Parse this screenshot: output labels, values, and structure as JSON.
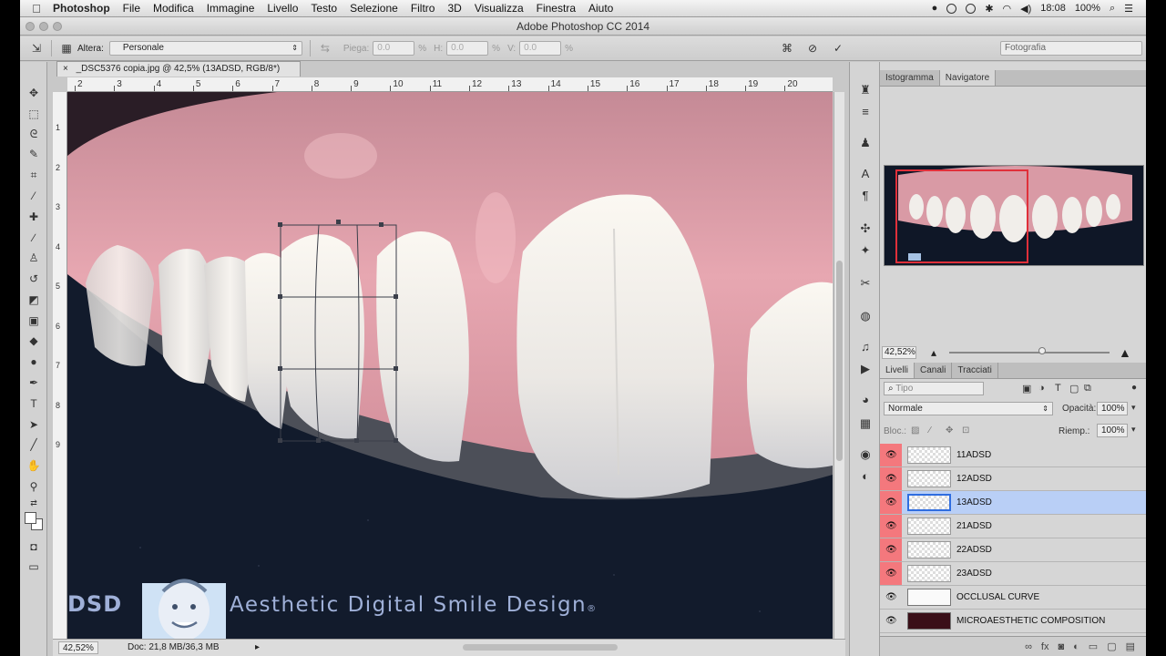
{
  "menubar": {
    "apple": "",
    "app": "Photoshop",
    "items": [
      "File",
      "Modifica",
      "Immagine",
      "Livello",
      "Testo",
      "Selezione",
      "Filtro",
      "3D",
      "Visualizza",
      "Finestra",
      "Aiuto"
    ],
    "clock": "18:08",
    "battery": "100%"
  },
  "window": {
    "title": "Adobe Photoshop CC 2014"
  },
  "options": {
    "warp_label": "Altera:",
    "warp_value": "Personale",
    "bend_label": "Piega:",
    "bend_value": "0.0",
    "pct1": "%",
    "h_label": "H:",
    "h_value": "0.0",
    "pct2": "%",
    "v_label": "V:",
    "v_value": "0.0",
    "pct3": "%",
    "workspace": "Fotografia"
  },
  "document": {
    "tab": "_DSC5376 copia.jpg @ 42,5% (13ADSD, RGB/8*)",
    "ruler_h": [
      "2",
      "3",
      "4",
      "5",
      "6",
      "7",
      "8",
      "9",
      "10",
      "11",
      "12",
      "13",
      "14",
      "15",
      "16",
      "17",
      "18",
      "19",
      "20"
    ],
    "ruler_v": [
      "1",
      "2",
      "3",
      "4",
      "5",
      "6",
      "7",
      "8",
      "9"
    ],
    "watermark_prefix": "DSD",
    "watermark_text": "Aesthetic Digital Smile Design",
    "watermark_reg": "®"
  },
  "status": {
    "zoom": "42,52%",
    "doc": "Doc: 21,8 MB/36,3 MB"
  },
  "navigator": {
    "tabs": [
      "Istogramma",
      "Navigatore"
    ],
    "zoom": "42,52%",
    "zoom_level": 0.58
  },
  "layers_panel": {
    "tabs": [
      "Livelli",
      "Canali",
      "Tracciati"
    ],
    "filter_placeholder": "Tipo",
    "blend_mode": "Normale",
    "opacity_label": "Opacità:",
    "opacity_value": "100%",
    "lock_label": "Bloc.:",
    "fill_label": "Riemp.:",
    "fill_value": "100%",
    "layers": [
      {
        "name": "11ADSD",
        "visible": true,
        "marked": true,
        "selected": false
      },
      {
        "name": "12ADSD",
        "visible": true,
        "marked": true,
        "selected": false
      },
      {
        "name": "13ADSD",
        "visible": true,
        "marked": true,
        "selected": true
      },
      {
        "name": "21ADSD",
        "visible": true,
        "marked": true,
        "selected": false
      },
      {
        "name": "22ADSD",
        "visible": true,
        "marked": true,
        "selected": false
      },
      {
        "name": "23ADSD",
        "visible": true,
        "marked": true,
        "selected": false
      },
      {
        "name": "OCCLUSAL CURVE",
        "visible": true,
        "marked": false,
        "selected": false
      },
      {
        "name": "MICROAESTHETIC COMPOSITION",
        "visible": true,
        "marked": false,
        "selected": false
      }
    ]
  },
  "icons": {
    "eye": "👁",
    "cancel": "⊘",
    "commit": "✓",
    "search": "⌕",
    "wifi": "wifi-icon",
    "volume": "volume-icon"
  },
  "colors": {
    "accent": "#2f6de0",
    "layer_mark": "#f4787d",
    "nav_view": "#e0303a",
    "watermark": "#9fb0d8"
  }
}
